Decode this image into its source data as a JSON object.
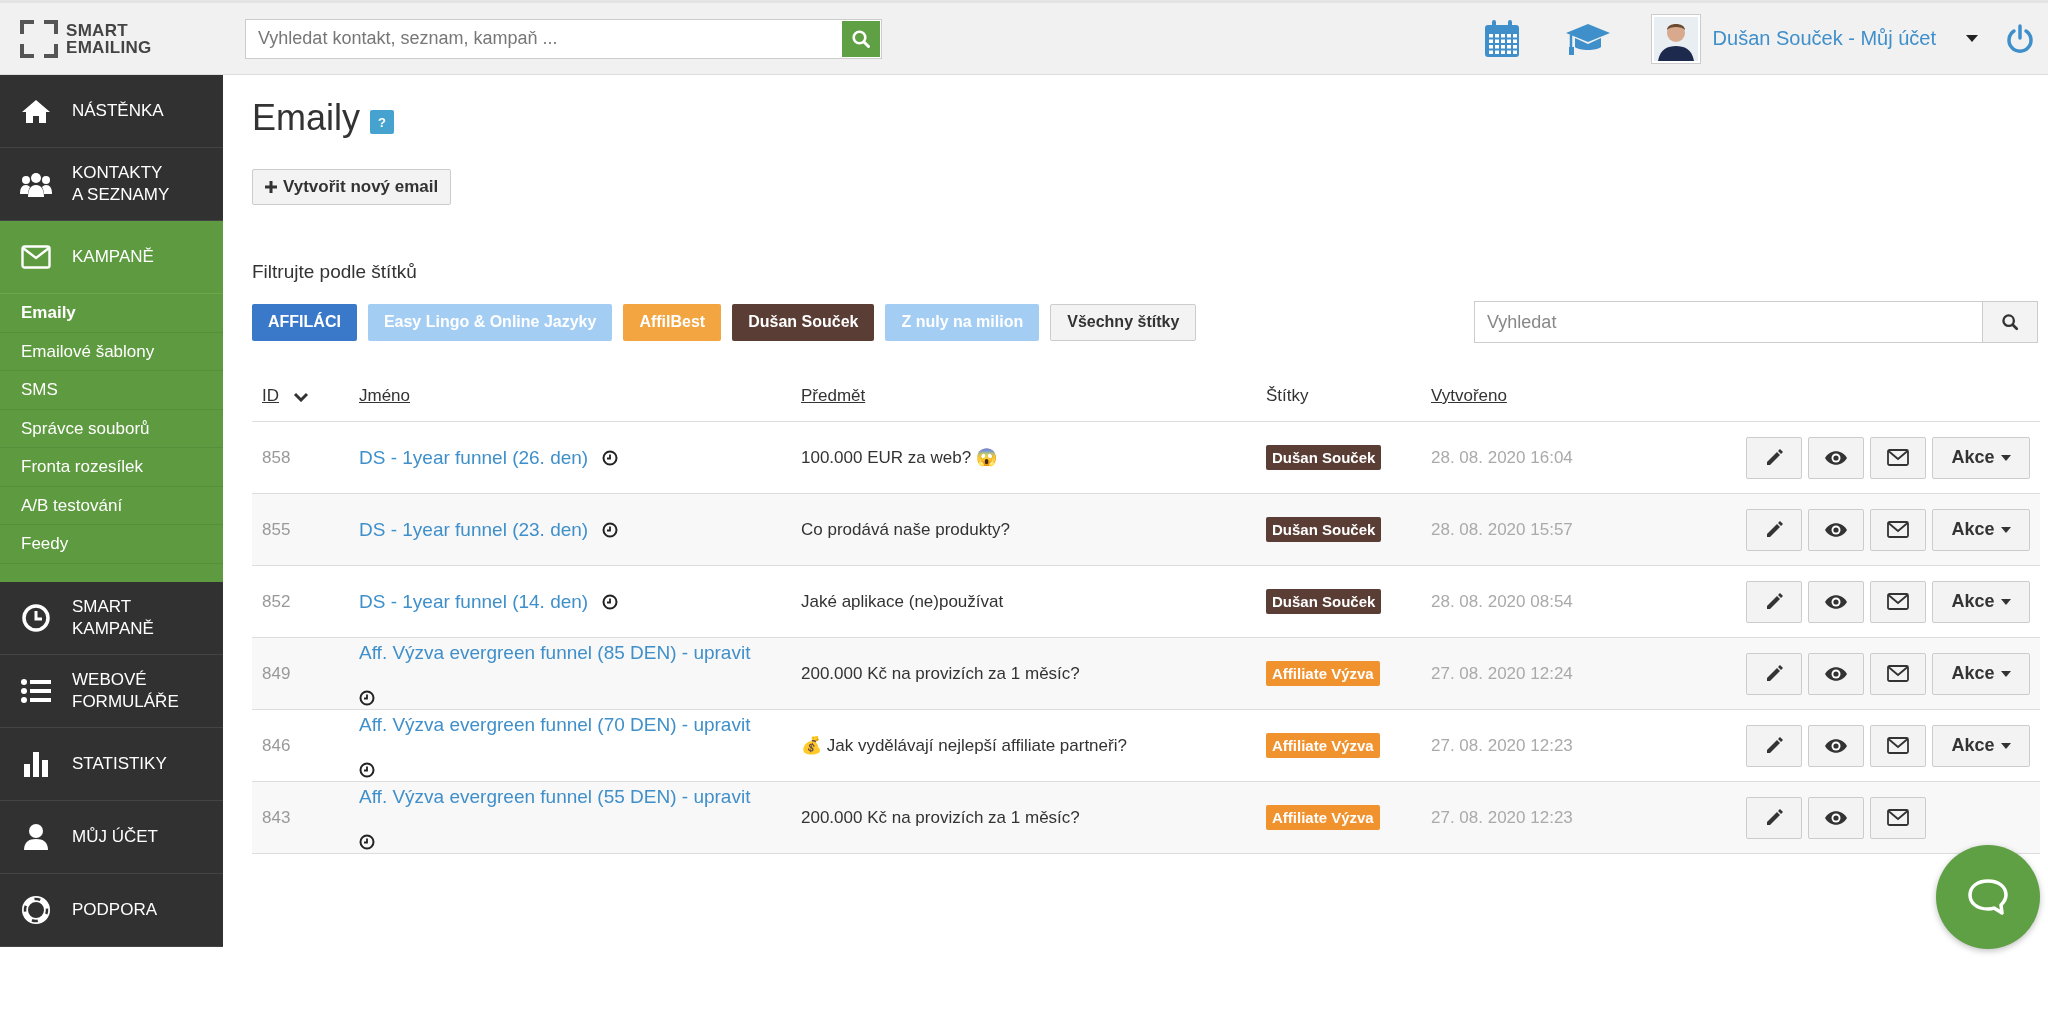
{
  "header": {
    "logo": [
      "SMART",
      "EMAILING"
    ],
    "search": {
      "placeholder": "Vyhledat kontakt, seznam, kampaň ..."
    },
    "user": "Dušan Souček - Můj účet"
  },
  "sidebar": {
    "items": [
      {
        "lines": [
          "NÁSTĚNKA"
        ],
        "selected": false
      },
      {
        "lines": [
          "KONTAKTY",
          "A SEZNAMY"
        ],
        "selected": false
      },
      {
        "lines": [
          "KAMPANĚ"
        ],
        "selected": true,
        "expanded": true,
        "children": [
          {
            "label": "Emaily",
            "selected": true
          },
          {
            "label": "Emailové šablony",
            "selected": false
          },
          {
            "label": "SMS",
            "selected": false
          },
          {
            "label": "Správce souborů",
            "selected": false
          },
          {
            "label": "Fronta rozesílek",
            "selected": false
          },
          {
            "label": "A/B testování",
            "selected": false
          },
          {
            "label": "Feedy",
            "selected": false
          }
        ]
      },
      {
        "lines": [
          "SMART",
          "KAMPANĚ"
        ],
        "selected": false
      },
      {
        "lines": [
          "WEBOVÉ",
          "FORMULÁŘE"
        ],
        "selected": false
      },
      {
        "lines": [
          "STATISTIKY"
        ],
        "selected": false
      },
      {
        "lines": [
          "MŮJ ÚČET"
        ],
        "selected": false
      },
      {
        "lines": [
          "PODPORA"
        ],
        "selected": false
      }
    ]
  },
  "page": {
    "title": "Emaily",
    "help": "?",
    "create_button": "Vytvořit nový email"
  },
  "filter": {
    "heading": "Filtrujte podle štítků",
    "tags": [
      {
        "kind": "tag",
        "label": "AFFILÁCI",
        "color": "#3a78c9"
      },
      {
        "kind": "tag",
        "label": "Easy Lingo & Online Jazyky",
        "color": "#a3cdf3"
      },
      {
        "kind": "tag",
        "label": "AffilBest",
        "color": "#f2a541"
      },
      {
        "kind": "tag",
        "label": "Dušan Souček",
        "color": "#5a3d34"
      },
      {
        "kind": "tag",
        "label": "Z nuly na milion",
        "color": "#a3cdf3"
      },
      {
        "kind": "all",
        "label": "Všechny štítky"
      }
    ],
    "search": {
      "placeholder": "Vyhledat"
    }
  },
  "table": {
    "columns": [
      {
        "label": "ID",
        "link": true,
        "sorted": true
      },
      {
        "label": "Jméno",
        "link": true,
        "sorted": false
      },
      {
        "label": "Předmět",
        "link": true,
        "sorted": false
      },
      {
        "label": "Štítky",
        "link": false,
        "sorted": false
      },
      {
        "label": "Vytvořeno",
        "link": true,
        "sorted": false
      }
    ],
    "rows": [
      {
        "id": "858",
        "name": "DS - 1year funnel (26. den)",
        "subject": "100.000 EUR za web? 😱",
        "tag": {
          "label": "Dušan Souček",
          "color": "#5a3d34"
        },
        "created": "28. 08. 2020 16:04",
        "menu": "Akce"
      },
      {
        "id": "855",
        "name": "DS - 1year funnel (23. den)",
        "subject": "Co prodává naše produkty?",
        "tag": {
          "label": "Dušan Souček",
          "color": "#5a3d34"
        },
        "created": "28. 08. 2020 15:57",
        "menu": "Akce"
      },
      {
        "id": "852",
        "name": "DS - 1year funnel (14. den)",
        "subject": "Jaké aplikace (ne)používat",
        "tag": {
          "label": "Dušan Souček",
          "color": "#5a3d34"
        },
        "created": "28. 08. 2020 08:54",
        "menu": "Akce"
      },
      {
        "id": "849",
        "name": "Aff. Výzva evergreen funnel (85 DEN) - upravit",
        "subject": "200.000 Kč na provizích za 1 měsíc?",
        "tag": {
          "label": "Affiliate Výzva",
          "color": "#f0922e"
        },
        "created": "27. 08. 2020 12:24",
        "menu": "Akce"
      },
      {
        "id": "846",
        "name": "Aff. Výzva evergreen funnel (70 DEN) - upravit",
        "subject": "💰 Jak vydělávají nejlepší affiliate partneři?",
        "tag": {
          "label": "Affiliate Výzva",
          "color": "#f0922e"
        },
        "created": "27. 08. 2020 12:23",
        "menu": "Akce"
      },
      {
        "id": "843",
        "name": "Aff. Výzva evergreen funnel (55 DEN) - upravit",
        "subject": "200.000 Kč na provizích za 1 měsíc?",
        "tag": {
          "label": "Affiliate Výzva",
          "color": "#f0922e"
        },
        "created": "27. 08. 2020 12:23"
      }
    ]
  }
}
